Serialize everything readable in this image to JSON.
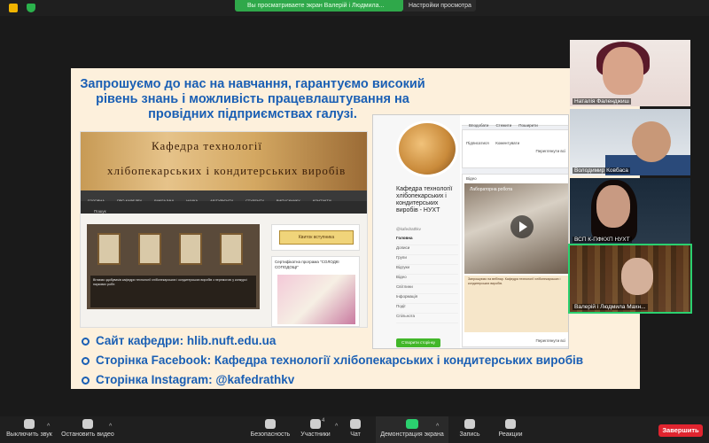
{
  "top": {
    "share_notice": "Вы просматриваете экран Валерій і Людмила...",
    "view_options": "Настройки просмотра"
  },
  "slide": {
    "heading": "Запрошуємо до нас на навчання, гарантуємо високий рівень знань і можливість працевлаштування на провідних підприємствах галузі.",
    "site": {
      "banner_line1": "Кафедра технології",
      "banner_line2": "хлібопекарських і кондитерських виробів",
      "nav": [
        "ГОЛОВНА",
        "ПРО КАФЕДРУ",
        "ВИКЛАДАЧІ",
        "НАУКА",
        "АБІТУРІЄНТУ",
        "СТУДЕНТУ",
        "ВИПУСКНИКУ",
        "КОНТАКТИ"
      ],
      "sub_item": "Пошук",
      "ticket": "Квиток вступника",
      "sidebar_title": "Сертифікатна програма \"СОЛОДКІ СОПОДОЩІ\"",
      "caption": "Вітаємо здобувачів кафедри технології хлібопекарських і кондитерських виробів з перемогою у конкурсі наукових робіт."
    },
    "fb": {
      "page_name": "Кафедра технології хлібопекарських і кондитерських виробів - НУХТ",
      "handle": "@kafedrathkv",
      "menu": [
        "Головна",
        "Допиcи",
        "Групи",
        "Відгуки",
        "Відео",
        "Світлини",
        "Інформація",
        "Події",
        "Спільнота"
      ],
      "create_btn": "Створити сторінку",
      "tabs": [
        "Вподобати",
        "Стежити",
        "Поширити"
      ],
      "subscribe": "Підписатися",
      "comment": "Коментувати",
      "see_all": "Переглянути всі",
      "video_section": "Відео",
      "video_title": "Лабораторна робота",
      "post_text": "Запрошуємо на вебінар. Кафедра технології хлібопекарських і кондитерських виробів."
    },
    "links": [
      "Сайт кафедри:  hlib.nuft.edu.ua",
      "Сторінка Facebook:  Кафедра технології хлібопекарських і кондитерських виробів",
      "Сторінка Instagram:  @kafedrathkv"
    ]
  },
  "participants": [
    "Наталія Фаленджиш",
    "Володимир Ковбаса",
    "ВСП К-ПФКХП НУХТ",
    "Валерій і Людмила Махн..."
  ],
  "toolbar": {
    "mute": "Выключить звук",
    "video": "Остановить видео",
    "security": "Безопасность",
    "participants": "Участники",
    "participants_count": "4",
    "chat": "Чат",
    "share": "Демонстрация экрана",
    "record": "Запись",
    "reactions": "Реакции",
    "end": "Завершить"
  },
  "colors": {
    "slide_bg": "#fdf0dc",
    "accent_blue": "#1a5fb4",
    "share_green": "#2fa84a",
    "end_red": "#e0242f"
  }
}
